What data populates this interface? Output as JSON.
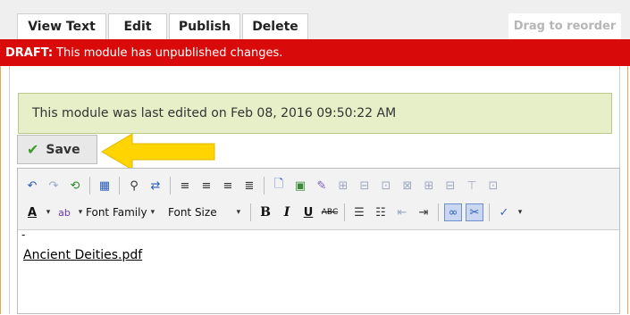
{
  "tabs": [
    {
      "label": "View Text"
    },
    {
      "label": "Edit"
    },
    {
      "label": "Publish"
    },
    {
      "label": "Delete"
    }
  ],
  "drag": {
    "label": "Drag to reorder"
  },
  "draft": {
    "label": "DRAFT:",
    "message": "This module has unpublished changes."
  },
  "notice": {
    "text": "This module was last edited on Feb 08, 2016 09:50:22 AM"
  },
  "save": {
    "label": "Save",
    "icon": "check-icon"
  },
  "toolbar": {
    "font_family": "Font Family",
    "font_size": "Font Size",
    "bold": "B",
    "italic": "I",
    "underline": "U",
    "strike": "ABC"
  },
  "editor": {
    "dash": "-",
    "link": "Ancient Deities.pdf"
  },
  "colors": {
    "draft_bg": "#d80a0a",
    "notice_bg": "#e6efc8",
    "arrow": "#ffd400",
    "link": "#000000"
  }
}
